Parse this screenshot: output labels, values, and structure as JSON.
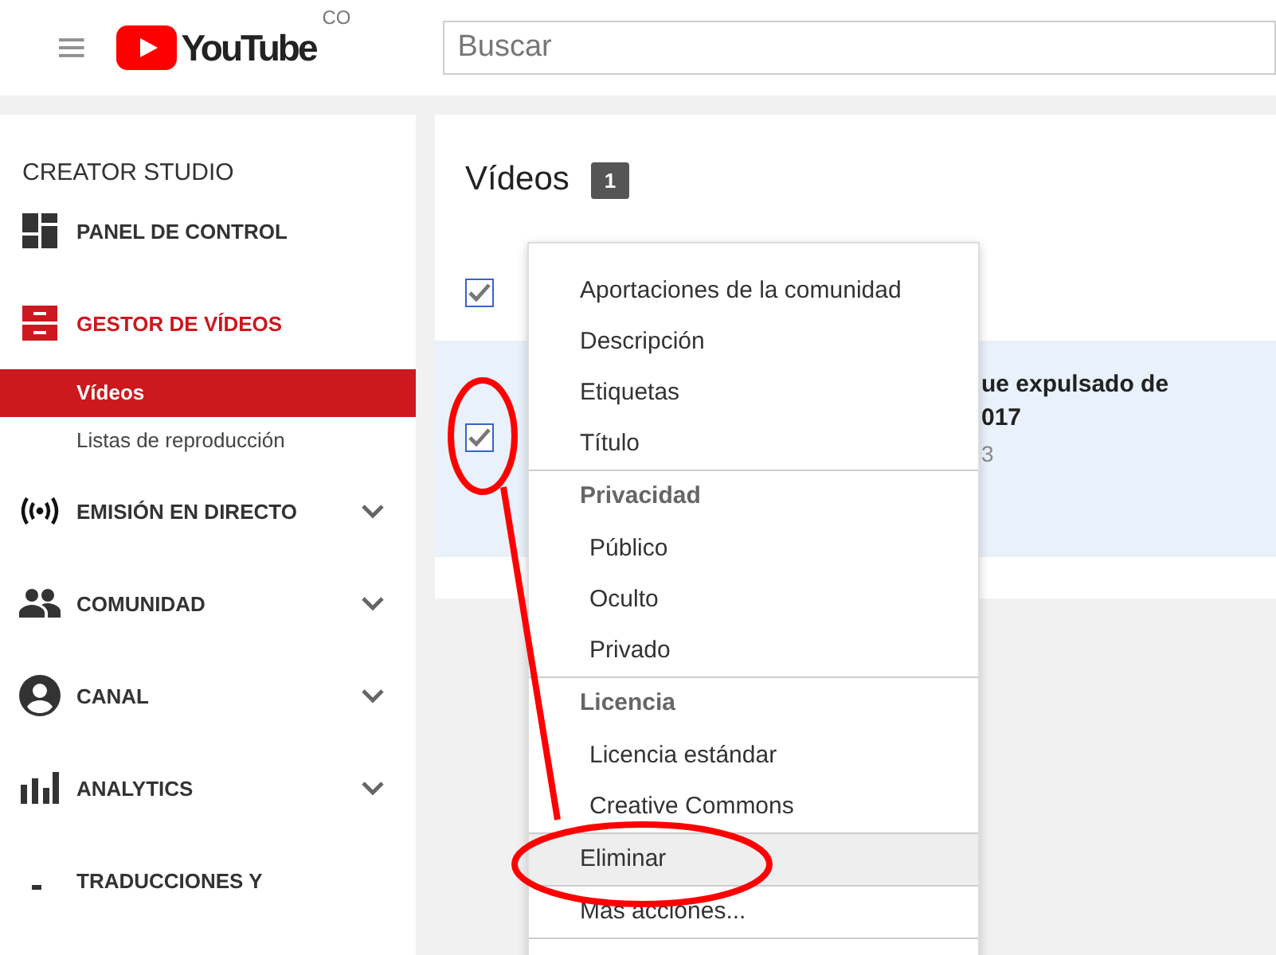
{
  "header": {
    "logo_text": "YouTube",
    "country": "CO",
    "search": {
      "placeholder": "Buscar"
    }
  },
  "sidebar": {
    "title": "CREATOR STUDIO",
    "items": [
      {
        "label": "PANEL DE CONTROL",
        "selected": false,
        "expandable": false
      },
      {
        "label": "GESTOR DE VÍDEOS",
        "selected": true,
        "expandable": false,
        "children": [
          {
            "label": "Vídeos",
            "selected": true
          },
          {
            "label": "Listas de reproducción",
            "selected": false
          }
        ]
      },
      {
        "label": "EMISIÓN EN DIRECTO",
        "selected": false,
        "expandable": true
      },
      {
        "label": "COMUNIDAD",
        "selected": false,
        "expandable": true
      },
      {
        "label": "CANAL",
        "selected": false,
        "expandable": true
      },
      {
        "label": "ANALYTICS",
        "selected": false,
        "expandable": true
      },
      {
        "label": "TRADUCCIONES Y",
        "selected": false,
        "expandable": false
      }
    ]
  },
  "content": {
    "title": "Vídeos",
    "count": "1",
    "select_all": {
      "checked": true
    },
    "rows": [
      {
        "checked": true,
        "title_lines": [
          "ue expulsado de",
          "017"
        ],
        "meta": "3"
      }
    ]
  },
  "menu": {
    "items": [
      {
        "kind": "action",
        "label": "Aportaciones de la comunidad",
        "divider_before": false,
        "highlighted": false
      },
      {
        "kind": "action",
        "label": "Descripción",
        "divider_before": false,
        "highlighted": false
      },
      {
        "kind": "action",
        "label": "Etiquetas",
        "divider_before": false,
        "highlighted": false
      },
      {
        "kind": "action",
        "label": "Título",
        "divider_before": false,
        "highlighted": false
      },
      {
        "kind": "header",
        "label": "Privacidad",
        "divider_before": true,
        "highlighted": false
      },
      {
        "kind": "option",
        "label": "Público",
        "divider_before": false,
        "highlighted": false
      },
      {
        "kind": "option",
        "label": "Oculto",
        "divider_before": false,
        "highlighted": false
      },
      {
        "kind": "option",
        "label": "Privado",
        "divider_before": false,
        "highlighted": false
      },
      {
        "kind": "header",
        "label": "Licencia",
        "divider_before": true,
        "highlighted": false
      },
      {
        "kind": "option",
        "label": "Licencia estándar",
        "divider_before": false,
        "highlighted": false
      },
      {
        "kind": "option",
        "label": "Creative Commons",
        "divider_before": false,
        "highlighted": false
      },
      {
        "kind": "action",
        "label": "Eliminar",
        "divider_before": true,
        "highlighted": true
      },
      {
        "kind": "action",
        "label": "Más acciones...",
        "divider_before": true,
        "highlighted": false
      }
    ]
  }
}
